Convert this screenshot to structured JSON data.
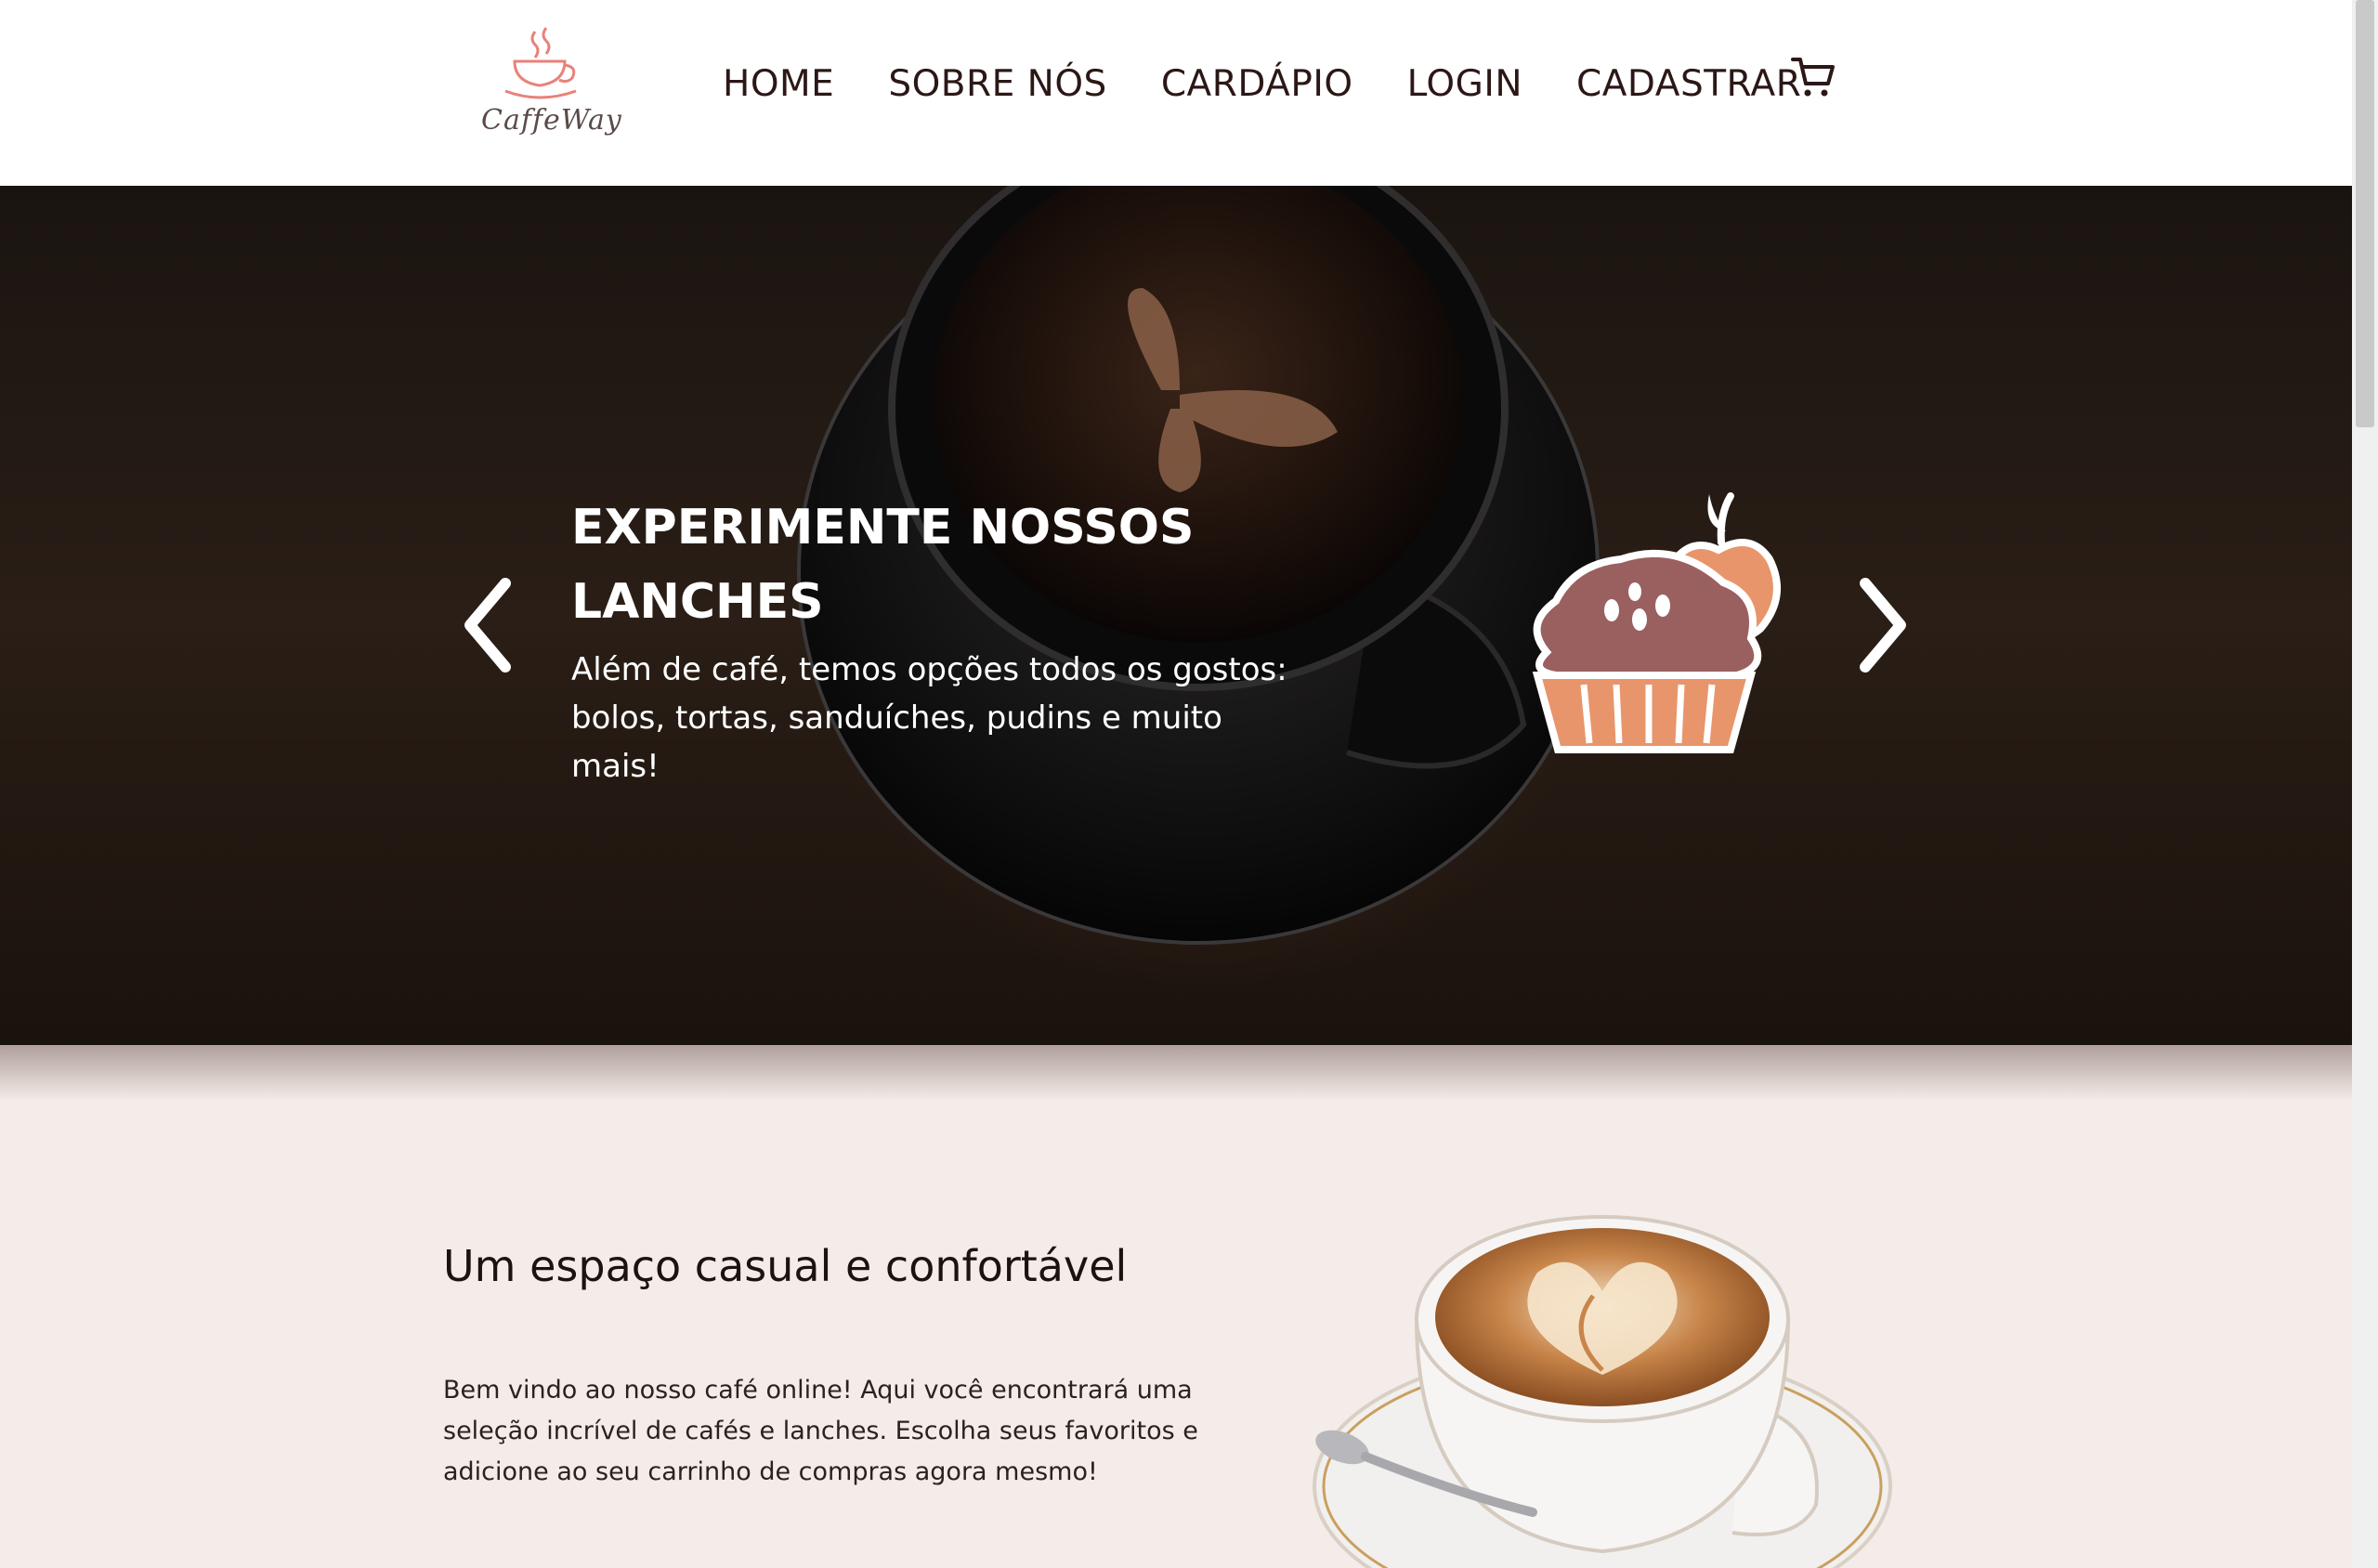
{
  "brand": {
    "logo_text": "CaffeWay"
  },
  "nav": {
    "items": [
      {
        "label": "HOME"
      },
      {
        "label": "SOBRE NÓS"
      },
      {
        "label": "CARDÁPIO"
      },
      {
        "label": "LOGIN"
      },
      {
        "label": "CADASTRAR"
      }
    ],
    "cart_icon": "cart-icon"
  },
  "hero": {
    "title": "EXPERIMENTE NOSSOS LANCHES",
    "text": "Além de café, temos opções todos os gostos: bolos, tortas, sanduíches, pudins e muito mais!",
    "prev_icon": "chevron-left-icon",
    "next_icon": "chevron-right-icon",
    "illustration": "muffin-apple-icon"
  },
  "about": {
    "title": "Um espaço casual e confortável",
    "text": "Bem vindo ao nosso café online! Aqui você encontrará uma seleção incrível de cafés e lanches. Escolha seus favoritos e adicione ao seu carrinho de compras agora mesmo!"
  },
  "colors": {
    "header_bg": "#ffffff",
    "nav_text": "#2b1816",
    "page_bg": "#f4ece8",
    "logo_accent": "#e8827a",
    "muffin_top": "#9a5f5f",
    "muffin_cup": "#e8956b"
  }
}
